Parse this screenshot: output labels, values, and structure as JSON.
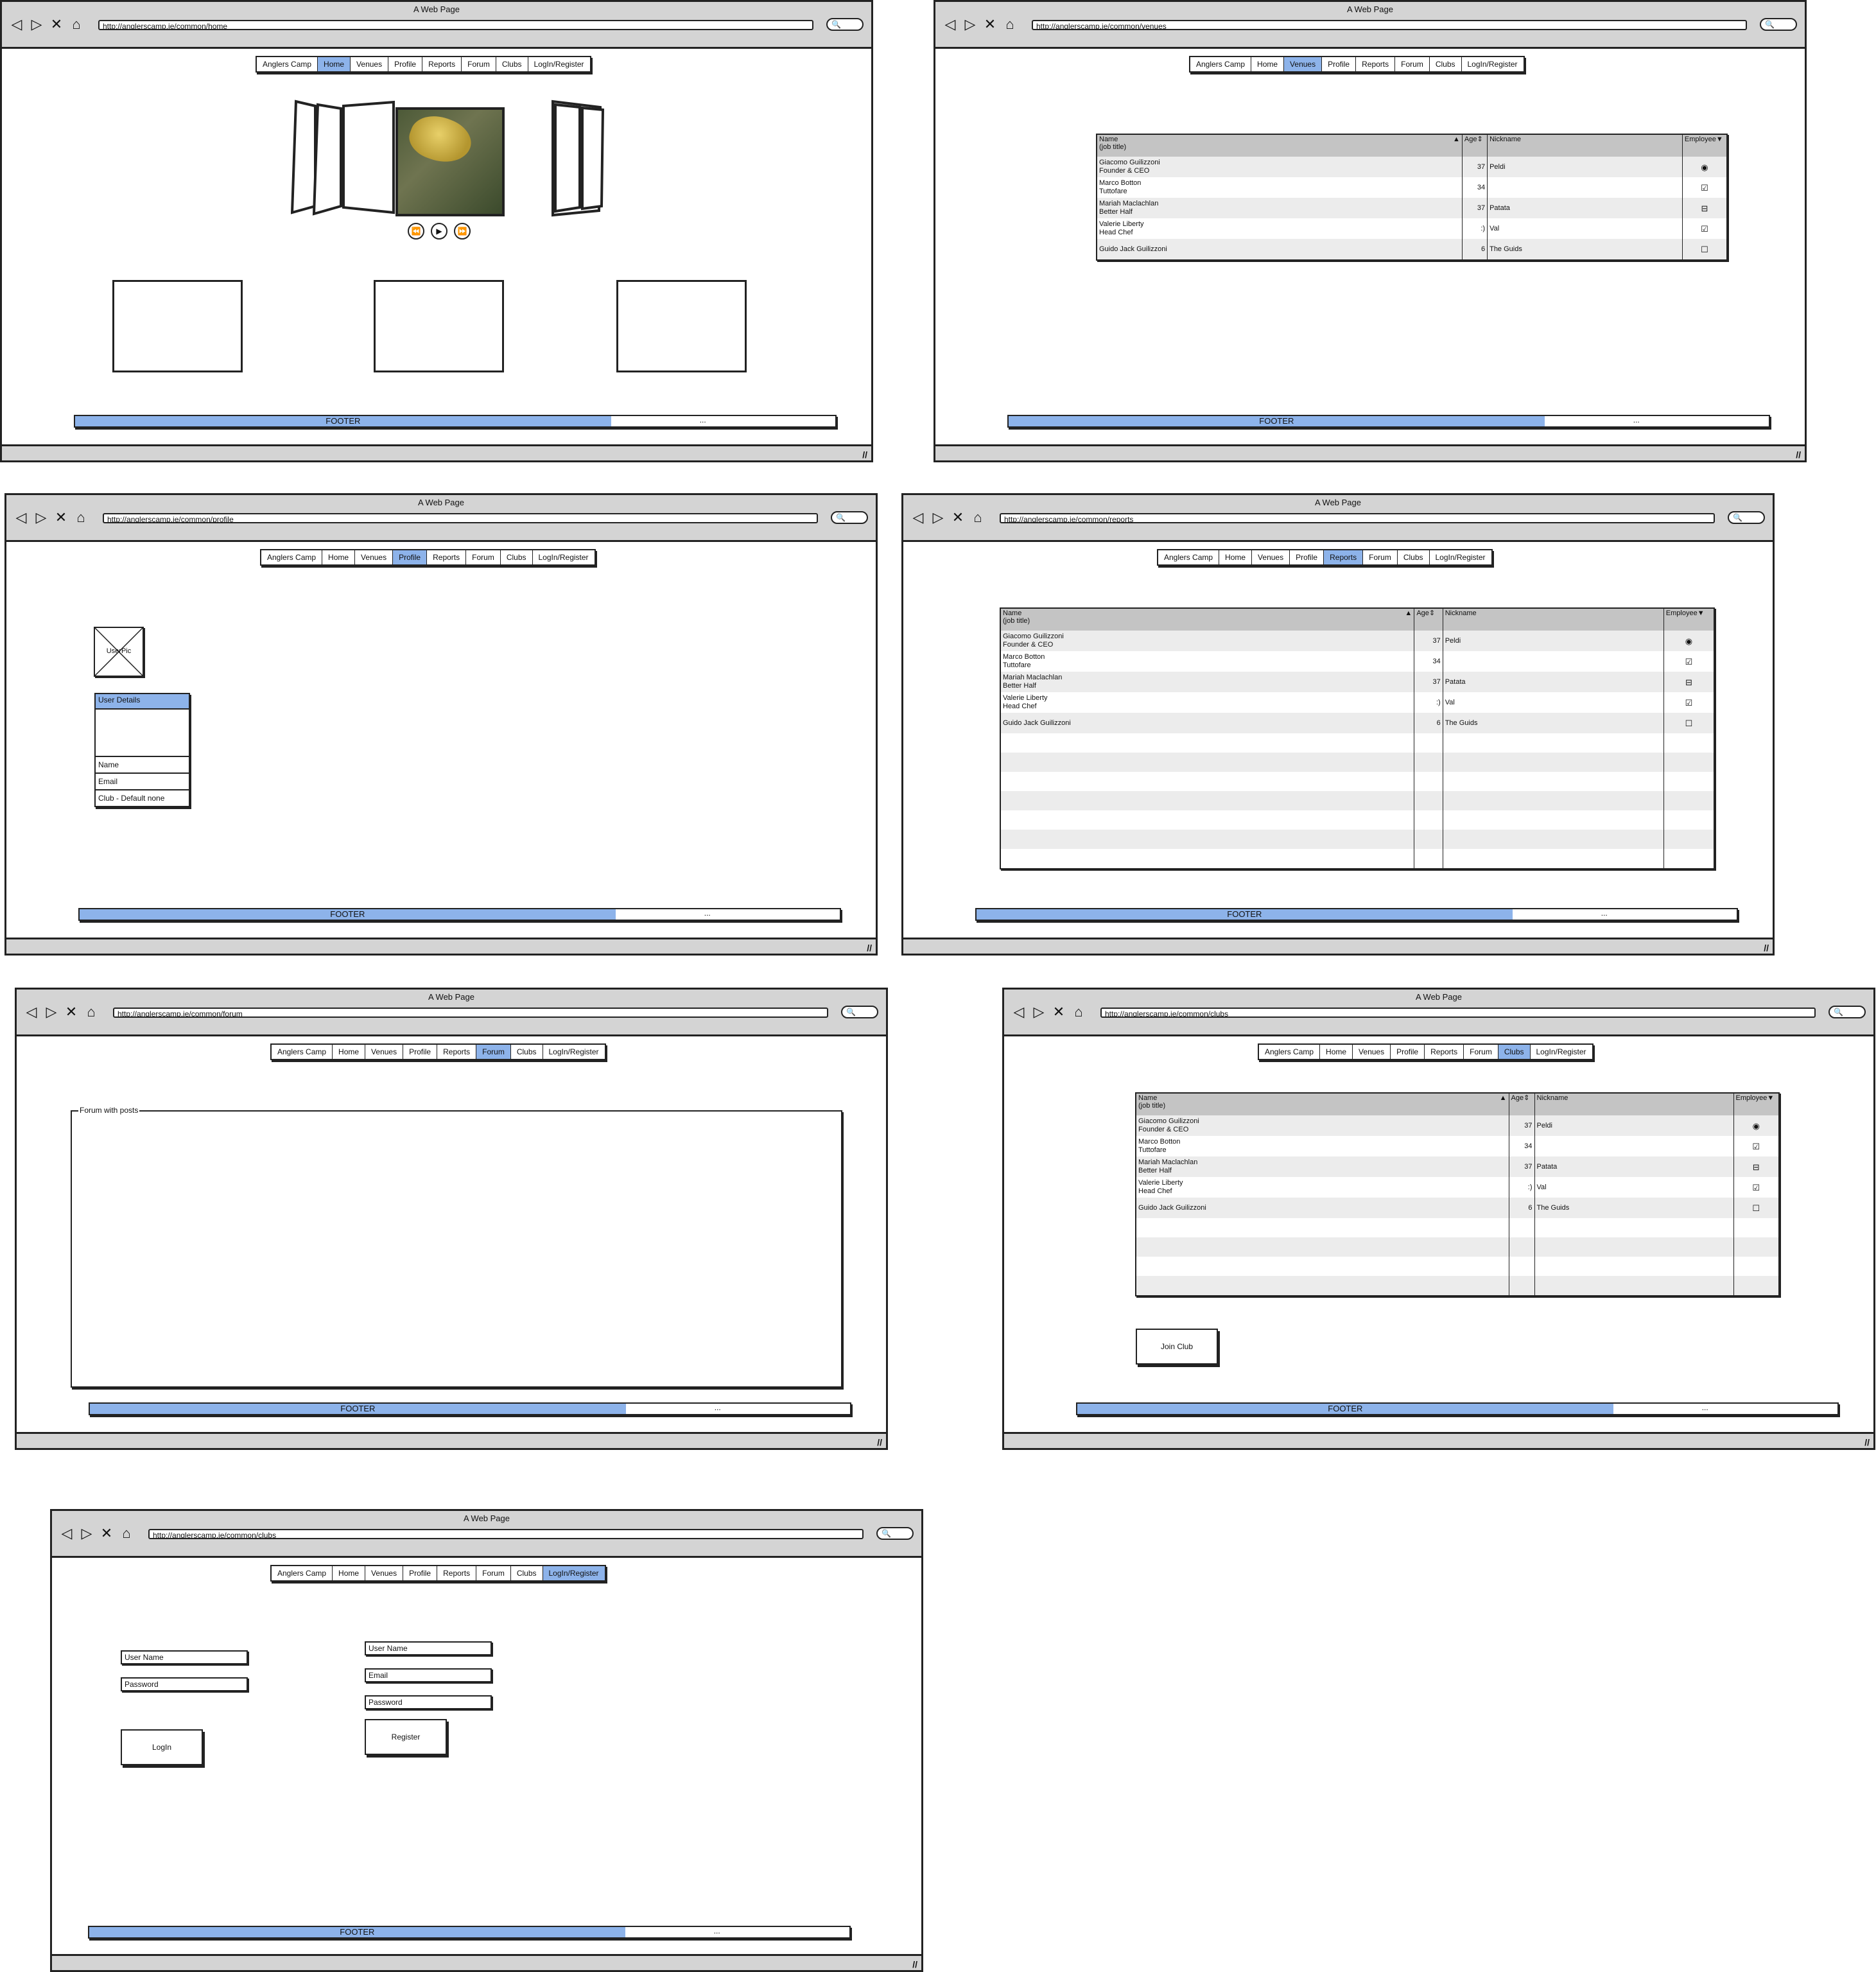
{
  "windows": {
    "home": {
      "title": "A Web Page",
      "url": "http://anglerscamp.ie/common/home",
      "active_tab": "Home",
      "footer": "FOOTER",
      "footer_right": "..."
    },
    "venues": {
      "title": "A Web Page",
      "url": "http://anglerscamp.ie/common/venues",
      "active_tab": "Venues",
      "footer": "FOOTER",
      "footer_right": "..."
    },
    "profile": {
      "title": "A Web Page",
      "url": "http://anglerscamp.ie/common/profile",
      "active_tab": "Profile",
      "footer": "FOOTER",
      "footer_right": "...",
      "userpic_label": "UserPic",
      "user_details_header": "User Details",
      "fields": [
        "Name",
        "Email",
        "Club - Default none"
      ]
    },
    "reports": {
      "title": "A Web Page",
      "url": "http://anglerscamp.ie/common/reports",
      "active_tab": "Reports",
      "footer": "FOOTER",
      "footer_right": "..."
    },
    "forum": {
      "title": "A Web Page",
      "url": "http://anglerscamp.ie/common/forum",
      "active_tab": "Forum",
      "footer": "FOOTER",
      "footer_right": "...",
      "forum_legend": "Forum with posts"
    },
    "clubs": {
      "title": "A Web Page",
      "url": "http://anglerscamp.ie/common/clubs",
      "active_tab": "Clubs",
      "footer": "FOOTER",
      "footer_right": "...",
      "join_button": "Join Club"
    },
    "login": {
      "title": "A Web Page",
      "url": "http://anglerscamp.ie/common/clubs",
      "active_tab": "LogIn/Register",
      "footer": "FOOTER",
      "footer_right": "...",
      "login_fields": [
        "User Name",
        "Password"
      ],
      "login_button": "LogIn",
      "register_fields": [
        "User Name",
        "Email",
        "Password"
      ],
      "register_button": "Register"
    }
  },
  "tabs": [
    "Anglers Camp",
    "Home",
    "Venues",
    "Profile",
    "Reports",
    "Forum",
    "Clubs",
    "LogIn/Register"
  ],
  "table": {
    "headers": {
      "name": "Name",
      "name_sub": "(job title)",
      "age": "Age",
      "nickname": "Nickname",
      "employee": "Employee"
    },
    "rows": [
      {
        "name": "Giacomo Guilizzoni",
        "title": "Founder & CEO",
        "age": "37",
        "nickname": "Peldi",
        "employee": "◉"
      },
      {
        "name": "Marco Botton",
        "title": "Tuttofare",
        "age": "34",
        "nickname": "",
        "employee": "☑"
      },
      {
        "name": "Mariah Maclachlan",
        "title": "Better Half",
        "age": "37",
        "nickname": "Patata",
        "employee": "⊟"
      },
      {
        "name": "Valerie Liberty",
        "title": "Head Chef",
        "age": ":)",
        "nickname": "Val",
        "employee": "☑"
      },
      {
        "name": "Guido Jack Guilizzoni",
        "title": "",
        "age": "6",
        "nickname": "The Guids",
        "employee": "☐"
      }
    ]
  },
  "icons": {
    "back": "◁",
    "forward": "▷",
    "close": "✕",
    "home": "⌂",
    "search": "🔍",
    "grip": "//",
    "rewind": "⏪",
    "play": "▶",
    "fast_forward": "⏩"
  },
  "colors": {
    "accent": "#8db3ea",
    "chrome": "#d4d4d4",
    "row_alt": "#ececec",
    "header": "#c4c4c4"
  }
}
